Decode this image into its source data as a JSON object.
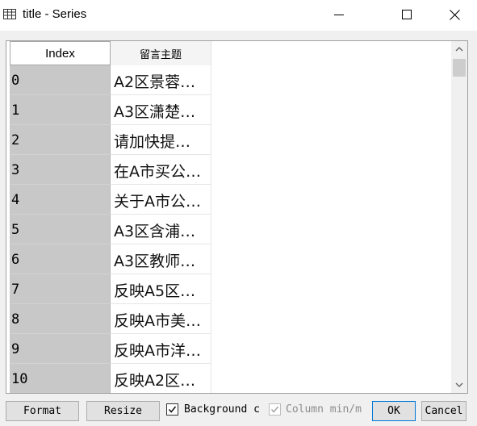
{
  "window": {
    "title": "title - Series",
    "icon": "table-icon"
  },
  "table": {
    "index_header": "Index",
    "column_header": "留言主题",
    "rows": [
      {
        "index": "0",
        "value": "A2区景蓉…"
      },
      {
        "index": "1",
        "value": "A3区潇楚…"
      },
      {
        "index": "2",
        "value": "请加快提…"
      },
      {
        "index": "3",
        "value": "在A市买公…"
      },
      {
        "index": "4",
        "value": "关于A市公…"
      },
      {
        "index": "5",
        "value": "A3区含浦…"
      },
      {
        "index": "6",
        "value": "A3区教师…"
      },
      {
        "index": "7",
        "value": "反映A5区…"
      },
      {
        "index": "8",
        "value": "反映A市美…"
      },
      {
        "index": "9",
        "value": "反映A市洋…"
      },
      {
        "index": "10",
        "value": "反映A2区…"
      }
    ]
  },
  "footer": {
    "format_label": "Format",
    "resize_label": "Resize",
    "background_label": "Background c",
    "background_checked": true,
    "column_minmax_label": "Column min/m",
    "column_minmax_checked": true,
    "column_minmax_enabled": false,
    "ok_label": "OK",
    "cancel_label": "Cancel"
  }
}
